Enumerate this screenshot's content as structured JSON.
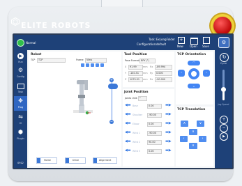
{
  "brand": {
    "name": "ELITE ROBOTS"
  },
  "topbar": {
    "status": "Normal",
    "task_label": "Task:",
    "task_value": "ExLongFolder",
    "config_label": "Configuration:",
    "config_value": "default",
    "buttons": [
      {
        "label": "New",
        "icon": "new-file-icon"
      },
      {
        "label": "Open",
        "icon": "open-folder-icon"
      },
      {
        "label": "Save",
        "icon": "save-icon"
      }
    ]
  },
  "leftnav": [
    {
      "label": "Run",
      "icon": "run-icon"
    },
    {
      "label": "Config",
      "icon": "gear-icon"
    },
    {
      "label": "Task",
      "icon": "task-icon"
    },
    {
      "label": "Prog",
      "icon": "move-icon"
    },
    {
      "label": "IO",
      "icon": "io-icon"
    },
    {
      "label": "Plugin",
      "icon": "plugin-icon"
    }
  ],
  "leftnav_footer": "0912",
  "robot_panel": {
    "title": "Robot",
    "tcp_label": "TCP",
    "tcp_value": "TCP",
    "frame_label": "Frame",
    "frame_value": "View",
    "buttons": [
      "Home",
      "Drive",
      "Alignment"
    ]
  },
  "tool_position": {
    "title": "Tool Position",
    "pose_format_label": "Pose Format",
    "pose_format_value": "RPY (°)",
    "rows": [
      {
        "axis": "X",
        "value": "91.99",
        "unit": "mm",
        "rot_axis": "Rx",
        "rot_value": "-89.994"
      },
      {
        "axis": "Y",
        "value": "-140.51",
        "unit": "mm",
        "rot_axis": "Ry",
        "rot_value": "0.000"
      },
      {
        "axis": "Z",
        "value": "1079.51",
        "unit": "mm",
        "rot_axis": "Rz",
        "rot_value": "-90.000"
      }
    ]
  },
  "joint_position": {
    "title": "Joint Position",
    "units_label": "Joints Unit:",
    "units_value": "°",
    "joints": [
      {
        "name": "Base",
        "value": "0.00"
      },
      {
        "name": "Shoulder",
        "value": "-90.00"
      },
      {
        "name": "Elbow",
        "value": "0.00"
      },
      {
        "name": "Wrist 1",
        "value": "-90.00"
      },
      {
        "name": "Wrist 2",
        "value": "90.00"
      },
      {
        "name": "Wrist 3",
        "value": "0.00"
      }
    ]
  },
  "tcp_orientation": {
    "title": "TCP Orientation"
  },
  "tcp_translation": {
    "title": "TCP Translation"
  },
  "rightbar": {
    "cycle_label": "Cycle",
    "speed_label": "Jog Speed",
    "speed_fraction": 0.35
  }
}
